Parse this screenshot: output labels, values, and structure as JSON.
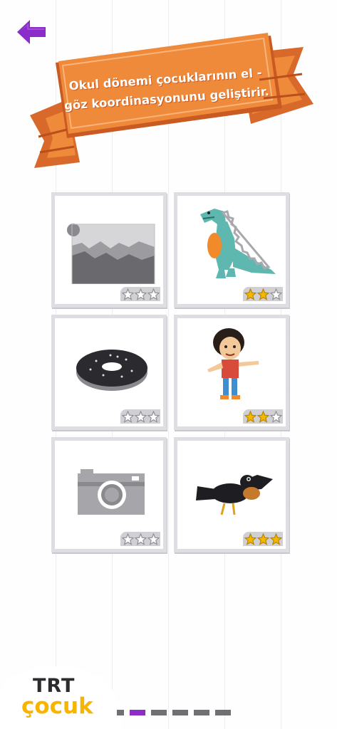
{
  "banner": {
    "text": "Okul dönemi çocuklarının el - göz koordinasyonunu geliştirir."
  },
  "colors": {
    "accent": "#8a2dc9",
    "banner": "#f08a3b",
    "banner_dark": "#d9692a",
    "star_gold": "#f5b800",
    "star_gray": "#8e8e94"
  },
  "cards": [
    {
      "subject": "mountain-landscape-picture",
      "stars_earned": 0,
      "stars_total": 3
    },
    {
      "subject": "dinosaur-picture",
      "stars_earned": 2,
      "stars_total": 3
    },
    {
      "subject": "donut-picture",
      "stars_earned": 0,
      "stars_total": 3
    },
    {
      "subject": "boy-character-picture",
      "stars_earned": 2,
      "stars_total": 3
    },
    {
      "subject": "camera-picture",
      "stars_earned": 0,
      "stars_total": 3
    },
    {
      "subject": "crow-picture",
      "stars_earned": 3,
      "stars_total": 3
    }
  ],
  "logo": {
    "line1": "TRT",
    "line2": "çocuk"
  },
  "pager": {
    "pages": 6,
    "active_index": 1
  }
}
